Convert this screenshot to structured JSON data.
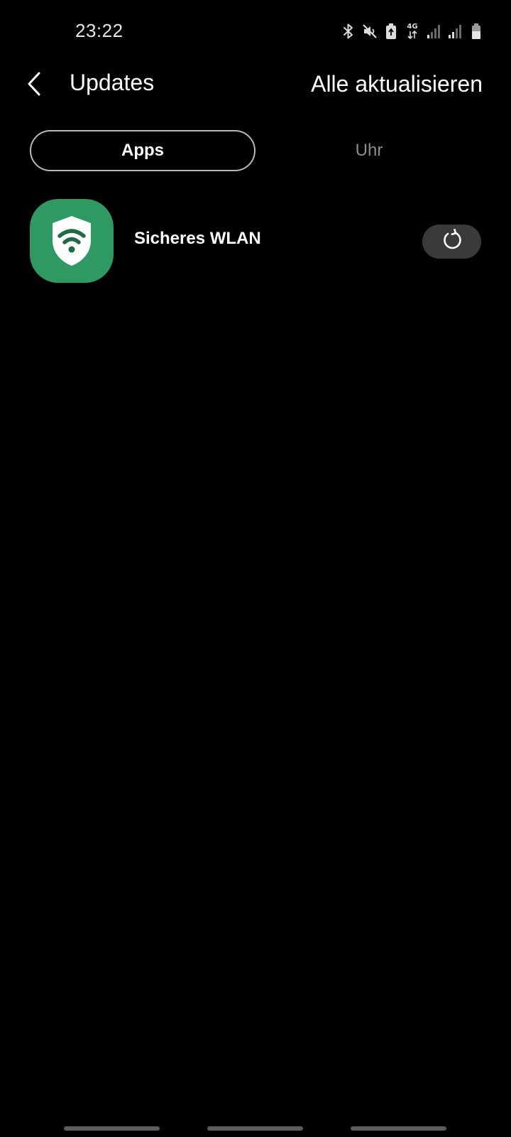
{
  "status_bar": {
    "time": "23:22",
    "network_label": "4G",
    "icons": [
      "bluetooth-icon",
      "mute-icon",
      "battery-saver-icon",
      "mobile-data-icon",
      "signal-icon",
      "signal-icon",
      "battery-icon"
    ]
  },
  "header": {
    "title": "Updates",
    "update_all_label": "Alle aktualisieren",
    "back_icon": "chevron-left-icon"
  },
  "tabs": [
    {
      "label": "Apps",
      "selected": true
    },
    {
      "label": "Uhr",
      "selected": false
    }
  ],
  "apps": [
    {
      "name": "Sicheres WLAN",
      "icon": "secure-wifi-shield-icon",
      "icon_color": "#2e9a62",
      "action_icon": "update-refresh-icon"
    }
  ],
  "colors": {
    "background": "#000000",
    "text": "#ffffff",
    "tab_inactive": "#8d8d8d",
    "button_bg": "#3a3a3a"
  }
}
